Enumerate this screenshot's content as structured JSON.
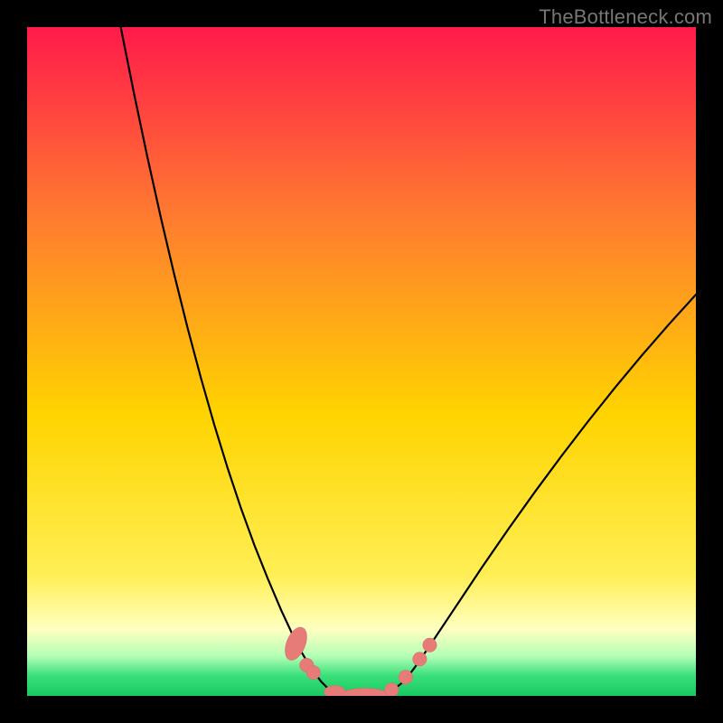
{
  "attribution": "TheBottleneck.com",
  "colors": {
    "bgBlack": "#000000",
    "gradTop": "#ff1a4b",
    "gradUpperMid": "#ff7a30",
    "gradMid": "#ffd400",
    "gradLowYellow": "#ffef55",
    "gradPaleYellow": "#ffffc0",
    "gradPaleGreen": "#b6ffb6",
    "gradGreen": "#39e07a",
    "gradBottomGreen": "#18c95f",
    "curveStroke": "#000000",
    "dotFill": "#e77b78",
    "dotStroke": "#d96a66"
  },
  "chart_data": {
    "type": "line",
    "title": "",
    "xlabel": "",
    "ylabel": "",
    "xlim": [
      0,
      100
    ],
    "ylim": [
      0,
      100
    ],
    "grid": false,
    "legend": false,
    "series": [
      {
        "name": "left-branch",
        "x": [
          14,
          16,
          18,
          20,
          22,
          24,
          26,
          28,
          30,
          32,
          34,
          36,
          38,
          40,
          41,
          42,
          43,
          44,
          45
        ],
        "y": [
          100,
          90,
          80.5,
          71.5,
          63,
          55,
          47.5,
          40.5,
          34,
          28,
          22.5,
          17.5,
          12.8,
          8.5,
          6.6,
          4.9,
          3.4,
          2.1,
          1.1
        ]
      },
      {
        "name": "right-branch",
        "x": [
          55,
          56,
          57,
          58,
          60,
          64,
          68,
          72,
          76,
          80,
          84,
          88,
          92,
          96,
          100
        ],
        "y": [
          1.1,
          1.9,
          3.0,
          4.3,
          7.2,
          13.2,
          19.2,
          25.0,
          30.6,
          36.0,
          41.2,
          46.2,
          51.0,
          55.6,
          60.0
        ]
      },
      {
        "name": "flat-bottom",
        "x": [
          45,
          46,
          47,
          48,
          49,
          50,
          51,
          52,
          53,
          54,
          55
        ],
        "y": [
          1.1,
          0.6,
          0.3,
          0.15,
          0.08,
          0.05,
          0.08,
          0.15,
          0.3,
          0.6,
          1.1
        ]
      }
    ],
    "markers": [
      {
        "shape": "pill",
        "cx": 40.2,
        "cy": 7.8,
        "rx": 1.4,
        "ry": 2.6,
        "rot": 22
      },
      {
        "shape": "dot",
        "cx": 41.8,
        "cy": 4.6,
        "r": 1.05
      },
      {
        "shape": "dot",
        "cx": 42.8,
        "cy": 3.5,
        "r": 1.05
      },
      {
        "shape": "pill",
        "cx": 46.0,
        "cy": 0.6,
        "rx": 1.6,
        "ry": 0.95,
        "rot": 0
      },
      {
        "shape": "pill",
        "cx": 50.5,
        "cy": 0.2,
        "rx": 3.4,
        "ry": 0.95,
        "rot": 0
      },
      {
        "shape": "dot",
        "cx": 54.5,
        "cy": 0.9,
        "r": 1.05
      },
      {
        "shape": "dot",
        "cx": 56.6,
        "cy": 2.8,
        "r": 1.05
      },
      {
        "shape": "dot",
        "cx": 58.7,
        "cy": 5.5,
        "r": 1.05
      },
      {
        "shape": "dot",
        "cx": 60.2,
        "cy": 7.6,
        "r": 1.05
      }
    ]
  }
}
